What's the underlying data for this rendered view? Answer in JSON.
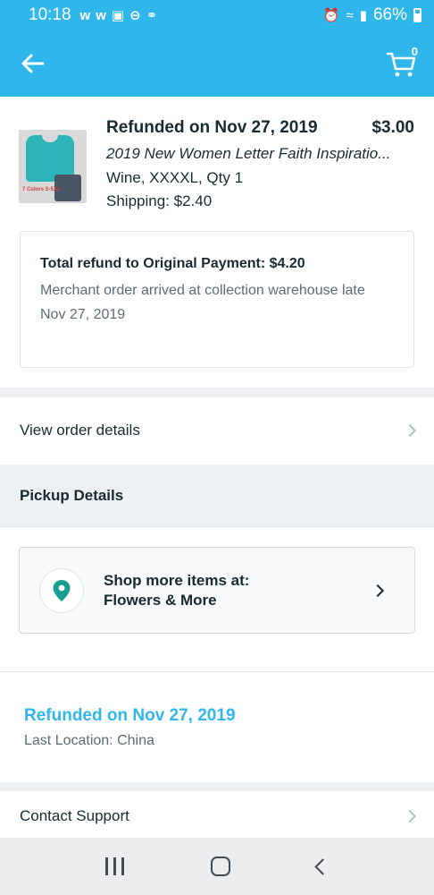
{
  "status_bar": {
    "time": "10:18",
    "battery": "66%",
    "left_icons": [
      "w",
      "w"
    ],
    "colors": {
      "background": "#2fb7ec"
    }
  },
  "app_bar": {
    "back_icon": "arrow-left-icon",
    "cart_icon": "cart-icon",
    "cart_count": "0",
    "colors": {
      "background": "#2fb7ec",
      "accent": "#2fb7ec"
    }
  },
  "item": {
    "title": "Refunded on Nov 27, 2019",
    "price": "$3.00",
    "name": "2019 New Women Letter Faith Inspiratio...",
    "variant": "Wine, XXXXL, Qty 1",
    "shipping": "Shipping: $2.40",
    "thumbnail_tag": "7 Colors S-5XL"
  },
  "refund": {
    "total": "Total refund to Original Payment: $4.20",
    "reason": "Merchant order arrived at collection warehouse late",
    "date": "Nov 27, 2019"
  },
  "view_order": {
    "label": "View order details"
  },
  "pickup": {
    "header": "Pickup Details",
    "shop_line1": "Shop more items at:",
    "shop_line2": "Flowers & More",
    "pin_icon": "location-pin-icon"
  },
  "tracking": {
    "status": "Refunded on Nov 27, 2019",
    "location": "Last Location: China"
  },
  "support": {
    "label": "Contact Support"
  },
  "nav": {
    "recent_icon": "recent-apps-icon",
    "home_icon": "home-icon",
    "back_icon": "back-icon"
  }
}
